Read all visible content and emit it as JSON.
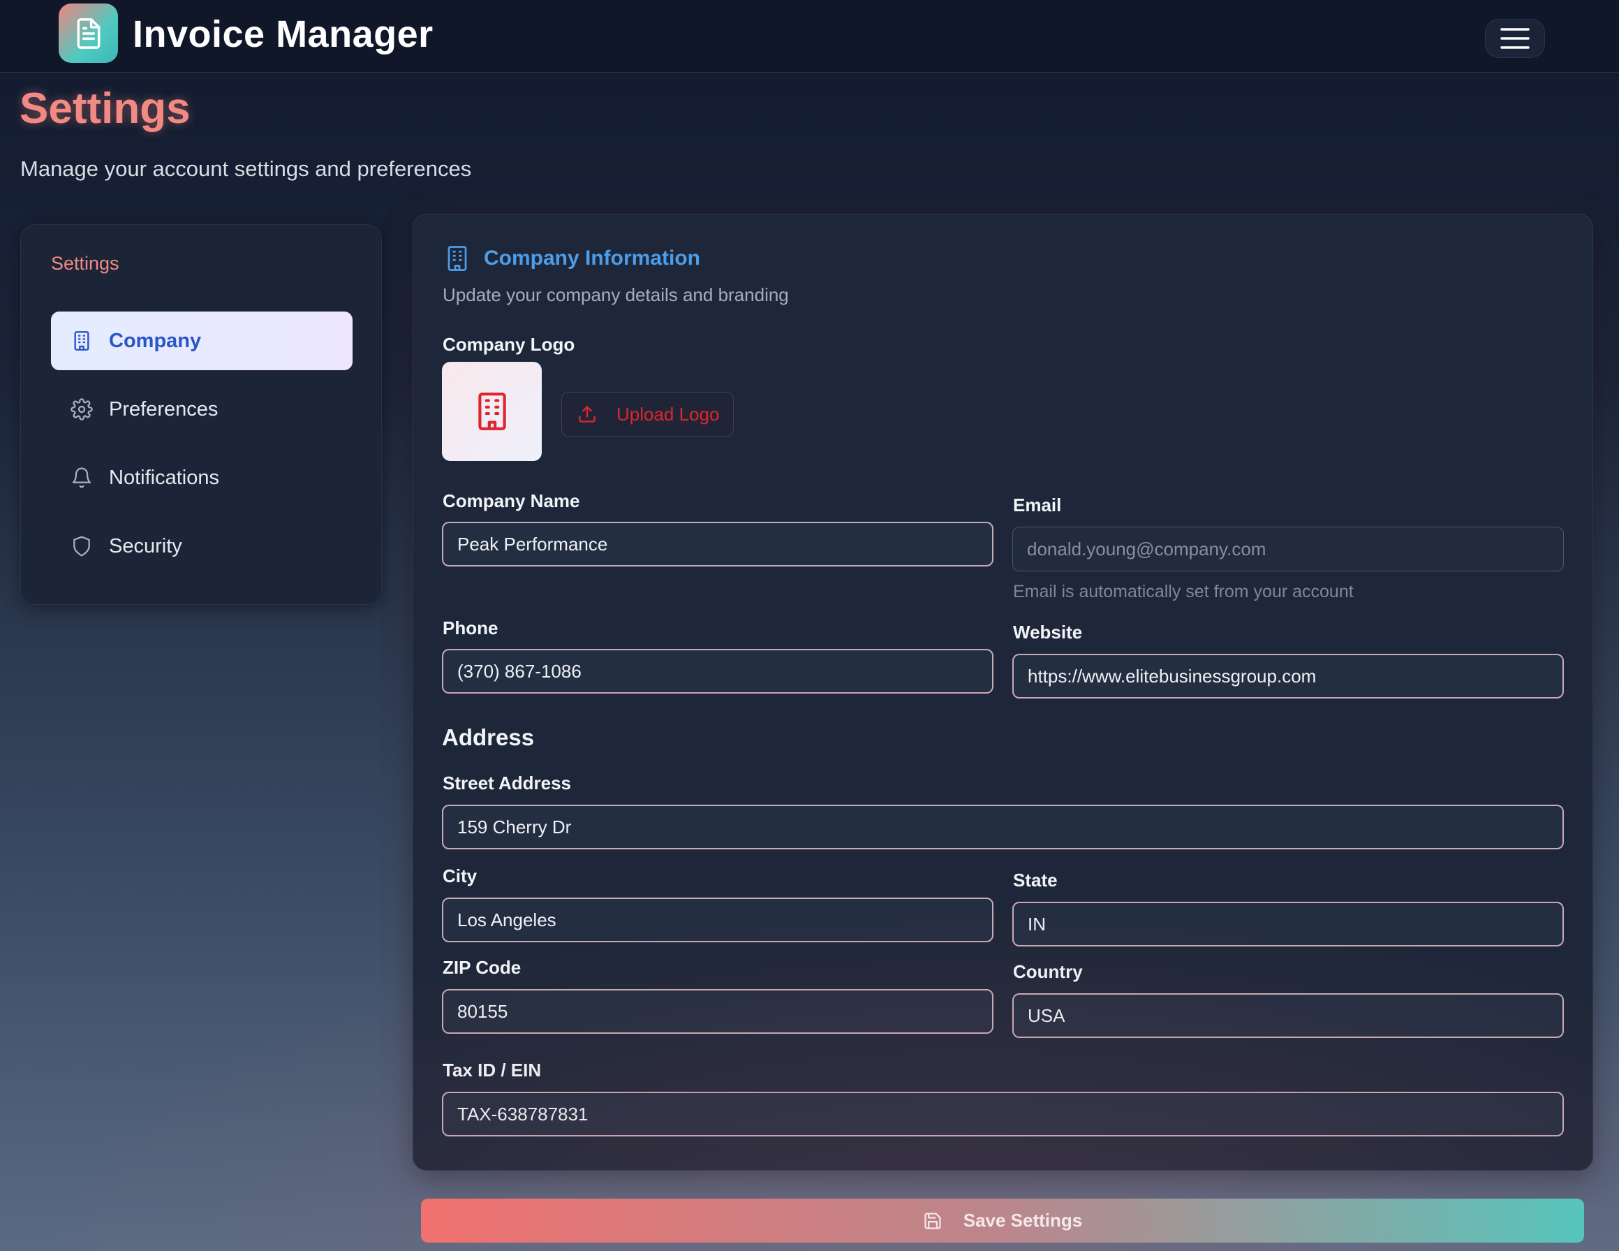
{
  "header": {
    "app_title": "Invoice Manager",
    "logo_icon": "document-icon",
    "menu_icon": "hamburger-menu-icon"
  },
  "page": {
    "title": "Settings",
    "subtitle": "Manage your account settings and preferences"
  },
  "sidebar": {
    "heading": "Settings",
    "items": [
      {
        "label": "Company",
        "icon": "building-icon",
        "active": true
      },
      {
        "label": "Preferences",
        "icon": "gear-icon",
        "active": false
      },
      {
        "label": "Notifications",
        "icon": "bell-icon",
        "active": false
      },
      {
        "label": "Security",
        "icon": "shield-icon",
        "active": false
      }
    ]
  },
  "company": {
    "section_title": "Company Information",
    "section_subtitle": "Update your company details and branding",
    "logo_label": "Company Logo",
    "upload_label": "Upload Logo",
    "fields": {
      "company_name": {
        "label": "Company Name",
        "value": "Peak Performance"
      },
      "email": {
        "label": "Email",
        "value": "donald.young@company.com",
        "hint": "Email is automatically set from your account"
      },
      "phone": {
        "label": "Phone",
        "value": "(370) 867-1086"
      },
      "website": {
        "label": "Website",
        "value": "https://www.elitebusinessgroup.com"
      }
    },
    "address_title": "Address",
    "address": {
      "street": {
        "label": "Street Address",
        "value": "159 Cherry Dr"
      },
      "city": {
        "label": "City",
        "value": "Los Angeles"
      },
      "state": {
        "label": "State",
        "value": "IN"
      },
      "zip": {
        "label": "ZIP Code",
        "value": "80155"
      },
      "country": {
        "label": "Country",
        "value": "USA"
      }
    },
    "tax": {
      "label": "Tax ID / EIN",
      "value": "TAX-638787831"
    }
  },
  "actions": {
    "save_label": "Save Settings",
    "save_icon": "floppy-disk-icon"
  },
  "colors": {
    "accent_coral": "#f28a83",
    "accent_teal": "#4ecbc1",
    "accent_blue": "#4c9dea",
    "danger_red": "#e0242e"
  }
}
